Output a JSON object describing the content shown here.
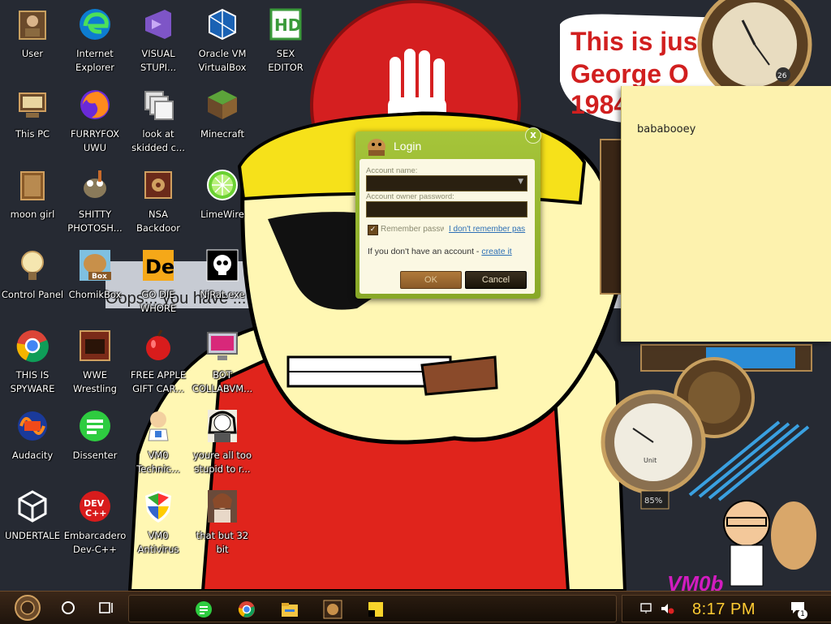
{
  "desktop_icons": [
    {
      "label": "User",
      "icon": "user-folder-icon"
    },
    {
      "label": "Internet\nExplorer",
      "icon": "edge-icon"
    },
    {
      "label": "VISUAL\nSTUPI...",
      "icon": "visual-studio-icon"
    },
    {
      "label": "Oracle VM\nVirtualBox",
      "icon": "virtualbox-icon"
    },
    {
      "label": "SEX\nEDITOR",
      "icon": "hxd-icon"
    },
    {
      "label": "This PC",
      "icon": "computer-icon"
    },
    {
      "label": "FURRYFOX\nUWU",
      "icon": "firefox-icon"
    },
    {
      "label": "look at\nskidded c...",
      "icon": "copy-windows-icon"
    },
    {
      "label": "Minecraft",
      "icon": "minecraft-icon"
    },
    {
      "label": "moon girl",
      "icon": "folder-icon"
    },
    {
      "label": "SHITTY\nPHOTOSH...",
      "icon": "gimp-icon"
    },
    {
      "label": "NSA\nBackdoor",
      "icon": "safe-icon"
    },
    {
      "label": "LimeWire",
      "icon": "limewire-icon"
    },
    {
      "label": "Control Panel",
      "icon": "lightbulb-icon"
    },
    {
      "label": "ChomikBox",
      "icon": "chomikbox-icon"
    },
    {
      "label": "GO DIE\nWHORE",
      "icon": "de-icon"
    },
    {
      "label": "NjRat.exe",
      "icon": "skull-icon"
    },
    {
      "label": "THIS IS\nSPYWARE",
      "icon": "chrome-icon"
    },
    {
      "label": "WWE\nWrestling",
      "icon": "oven-icon"
    },
    {
      "label": "FREE APPLE\nGIFT CAR...",
      "icon": "apple-icon"
    },
    {
      "label": "BOT\nCOLLABVM...",
      "icon": "monitor-icon"
    },
    {
      "label": "Audacity",
      "icon": "audacity-icon"
    },
    {
      "label": "Dissenter",
      "icon": "dissenter-icon"
    },
    {
      "label": "VM0\nTechnic...",
      "icon": "doctor-icon"
    },
    {
      "label": "youre all too\nstupid to r...",
      "icon": "portrait-icon"
    },
    {
      "label": "UNDERTALE",
      "icon": "unity-icon"
    },
    {
      "label": "Embarcadero\nDev-C++",
      "icon": "devcpp-icon"
    },
    {
      "label": "VM0\nAntivirus",
      "icon": "shield-icon"
    },
    {
      "label": "that but 32\nbit",
      "icon": "portrait-lady-icon"
    }
  ],
  "wallpaper": {
    "speech_text": "This is jus\nGeorge O\n1984",
    "banner_text": "Oops... you have ... has been deemed",
    "gauge_percent": "85%",
    "gauge_unit": "Unit",
    "clock_number": "26",
    "watermark": "VM0b"
  },
  "sticky_note": {
    "text": "bababooey"
  },
  "login_dialog": {
    "title": "Login",
    "account_name_label": "Account name:",
    "password_label": "Account owner password:",
    "remember_label": "Remember passw",
    "forgot_link": "I don't remember pas",
    "no_account_text": "If you don't have an account - ",
    "create_link": "create it",
    "ok_label": "OK",
    "cancel_label": "Cancel",
    "close_symbol": "x"
  },
  "taskbar": {
    "apps": [
      "dissenter-icon",
      "chrome-icon",
      "file-explorer-icon",
      "chomikbox-icon",
      "sticky-notes-icon"
    ],
    "clock": "8:17 PM",
    "notification_count": "1"
  },
  "colors": {
    "dialog_green": "#9bbd2f",
    "sticky": "#fdf2ae",
    "clock_yellow": "#ffcc33"
  }
}
